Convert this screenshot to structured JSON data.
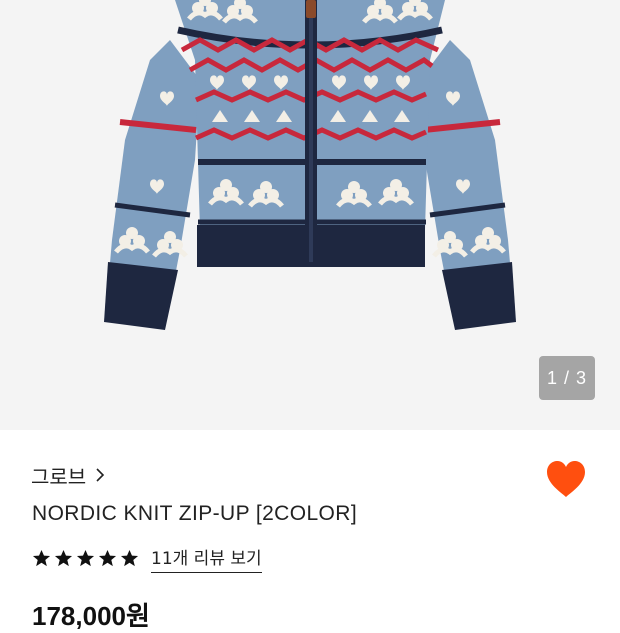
{
  "gallery": {
    "counter": "1 / 3"
  },
  "product": {
    "brand": "그로브",
    "name": "NORDIC KNIT ZIP-UP [2COLOR]",
    "rating": 5,
    "review_link": "11개 리뷰 보기",
    "price": "178,000원"
  },
  "colors": {
    "heart": "#ff4f0f",
    "sweater_blue": "#7f9fc0",
    "navy": "#1e2740",
    "red": "#c8283c",
    "cream": "#f3efe6"
  }
}
